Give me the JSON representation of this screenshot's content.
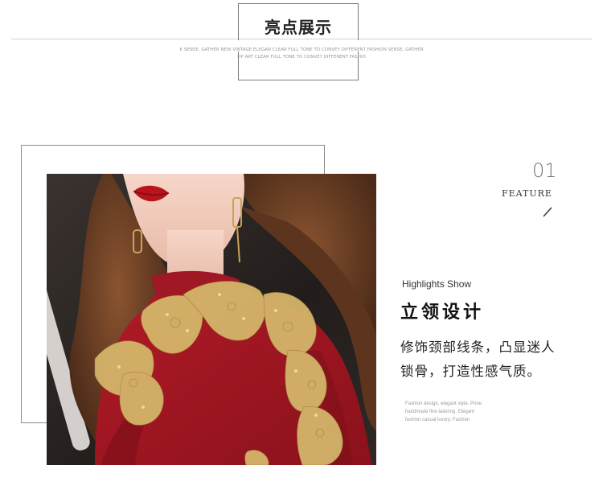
{
  "header": {
    "title": "亮点展示",
    "subtitle_line1": "K SENSE, GATHER NEW VINTAGE ELEGAN CLEAR FULL TONE TO CONVEY DIFFERENT FASHION SENSE, GATHER",
    "subtitle_line2": "OP ART CLEAR FULL TONE TO CONVEY DIFFERENT FASHIO"
  },
  "feature": {
    "number": "01",
    "label": "FEATURE"
  },
  "highlight": {
    "label": "Highlights Show",
    "title": "立领设计",
    "description_line1": "修饰颈部线条，凸显迷人",
    "description_line2": "锁骨，打造性感气质。",
    "fine_print_line1": "Fashion design, elegant style. Prine",
    "fine_print_line2": "handmade fine tailoring. Elegant",
    "fine_print_line3": "fashion casual luxury. Fashion"
  },
  "colors": {
    "dress_red": "#9c1620",
    "embroidery_gold": "#d4b56a",
    "lip_red": "#b8141c",
    "hair_brown": "#6a3e22",
    "background_dark": "#2a2523"
  }
}
